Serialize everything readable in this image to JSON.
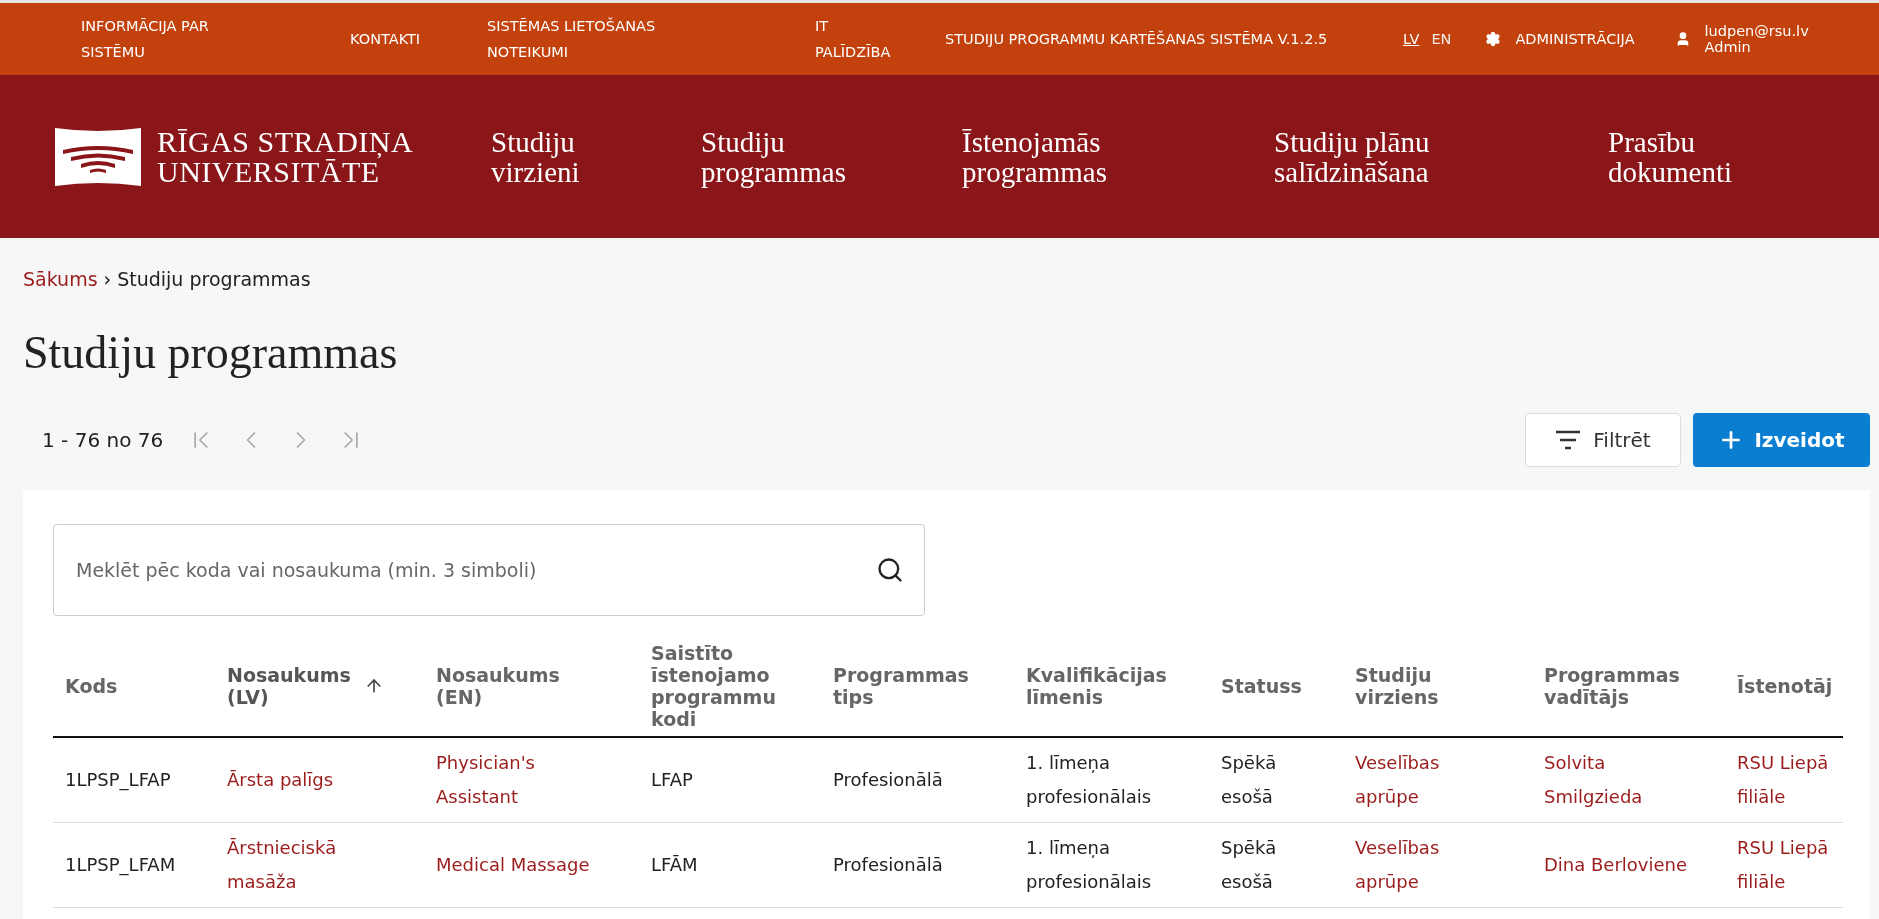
{
  "top_bar": {
    "links": [
      "INFORMĀCIJA PAR SISTĒMU",
      "KONTAKTI",
      "SISTĒMAS LIETOŠANAS NOTEIKUMI",
      "IT PALĪDZĪBA"
    ],
    "version": "STUDIJU PROGRAMMU KARTĒŠANAS SISTĒMA V.1.2.5",
    "languages": [
      {
        "label": "LV",
        "selected": true
      },
      {
        "label": "EN",
        "selected": false
      }
    ],
    "admin": "ADMINISTRĀCIJA",
    "user": {
      "email": "ludpen@rsu.lv",
      "role": "Admin"
    }
  },
  "header": {
    "logo": {
      "line1": "RĪGAS STRADIŅA",
      "line2": "UNIVERSITĀTE"
    },
    "nav": [
      "Studiju virzieni",
      "Studiju programmas",
      "Īstenojamās programmas",
      "Studiju plānu salīdzināšana",
      "Prasību dokumenti"
    ]
  },
  "breadcrumb": {
    "home": "Sākums",
    "separator": "›",
    "current": "Studiju programmas"
  },
  "title": "Studiju programmas",
  "pagination": "1 - 76 no 76",
  "buttons": {
    "filter": "Filtrēt",
    "create": "Izveidot"
  },
  "search": {
    "placeholder": "Meklēt pēc koda vai nosaukuma (min. 3 simboli)"
  },
  "table": {
    "columns": [
      {
        "label": "Kods",
        "sorted": false
      },
      {
        "label": "Nosaukums (LV)",
        "sorted": true
      },
      {
        "label": "Nosaukums (EN)",
        "sorted": false
      },
      {
        "label": "Saistīto īstenojamo programmu kodi",
        "sorted": false
      },
      {
        "label": "Programmas tips",
        "sorted": false
      },
      {
        "label": "Kvalifikācijas līmenis",
        "sorted": false
      },
      {
        "label": "Statuss",
        "sorted": false
      },
      {
        "label": "Studiju virziens",
        "sorted": false
      },
      {
        "label": "Programmas vadītājs",
        "sorted": false
      },
      {
        "label": "Īstenotāj",
        "sorted": false
      }
    ],
    "rows": [
      [
        "1LPSP_LFAP",
        "Ārsta palīgs",
        "Physician's Assistant",
        "LFAP",
        "Profesionālā",
        "1. līmeņa profesionālais",
        "Spēkā esošā",
        "Veselības aprūpe",
        "Solvita Smilgzieda",
        "RSU Liepā filiāle"
      ],
      [
        "1LPSP_LFAM",
        "Ārstnieciskā masāža",
        "Medical Massage",
        "LFĀM",
        "Profesionālā",
        "1. līmeņa profesionālais",
        "Spēkā esošā",
        "Veselības aprūpe",
        "Dina Berloviene",
        "RSU Liepā filiāle"
      ]
    ]
  }
}
